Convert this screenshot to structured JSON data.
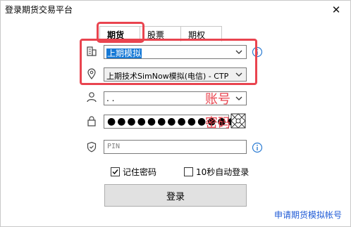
{
  "window": {
    "title": "登录期货交易平台",
    "close_glyph": "✕"
  },
  "tabs": [
    {
      "label": "期货",
      "active": true
    },
    {
      "label": "股票",
      "active": false
    },
    {
      "label": "期权",
      "active": false
    }
  ],
  "broker": {
    "value": "上期模拟",
    "icon": "building-icon"
  },
  "server": {
    "value": "上期技术SimNow模拟(电信) - CTP",
    "icon": "location-pin-icon"
  },
  "account": {
    "value": ".                .",
    "overlay_label": "账号",
    "icon": "user-icon"
  },
  "password": {
    "value": "●●●●●●●●●●●●●●",
    "overlay_label": "密码",
    "icon": "lock-icon"
  },
  "pin": {
    "placeholder": "PIN",
    "icon": "shield-icon"
  },
  "options": {
    "remember_password": {
      "label": "记住密码",
      "checked": true
    },
    "auto_login": {
      "label": "10秒自动登录",
      "checked": false
    }
  },
  "login_button": {
    "label": "登录"
  },
  "apply_link": {
    "label": "申请期货模拟帐号"
  },
  "colors": {
    "highlight": "#e9444f",
    "selection": "#1679d6",
    "link": "#1f5bd6",
    "info": "#2b7cd3"
  }
}
